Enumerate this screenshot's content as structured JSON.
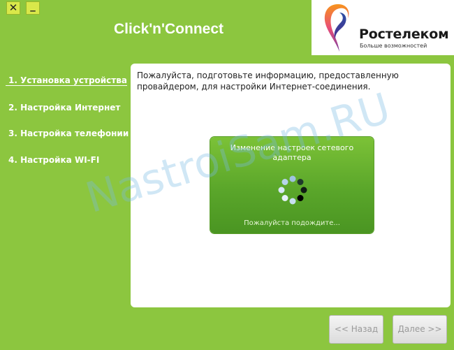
{
  "window": {
    "close_label": "✕",
    "minimize_label": "_"
  },
  "app": {
    "title": "Click'n'Connect"
  },
  "logo": {
    "name": "Ростелеком",
    "slogan": "Больше возможностей"
  },
  "steps": [
    {
      "label": "1. Установка устройства",
      "active": true
    },
    {
      "label": "2. Настройка Интернет",
      "active": false
    },
    {
      "label": "3. Настройка телефонии",
      "active": false
    },
    {
      "label": "4. Настройка WI-FI",
      "active": false
    }
  ],
  "main": {
    "info_text": "Пожалуйста, подготовьте информацию, предоставленную провайдером, для настройки Интернет-соединения."
  },
  "progress_dialog": {
    "title": "Изменение настроек сетевого адаптера",
    "status": "Пожалуйста подождите..."
  },
  "watermark": "NastroiSam.RU",
  "navigation": {
    "back_label": "<< Назад",
    "next_label": "Далее >>"
  },
  "colors": {
    "background": "#8cc63f",
    "dialog_green": "#5aa62a",
    "brand_orange": "#f36f21",
    "brand_blue": "#2d4ea3"
  }
}
